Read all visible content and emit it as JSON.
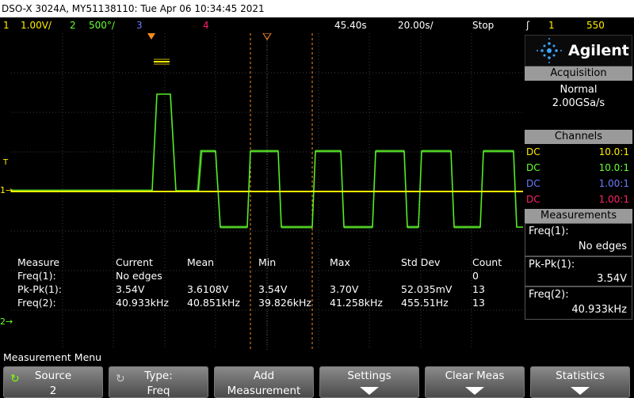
{
  "title": "DSO-X 3024A, MY51138110: Tue Apr 06 10:34:45 2021",
  "status": {
    "ch1_num": "1",
    "ch1_scale": "1.00V/",
    "ch2_num": "2",
    "ch2_scale": "500°/",
    "ch3_num": "3",
    "ch4_num": "4",
    "delay": "45.40s",
    "timebase": "20.00s/",
    "run_state": "Stop",
    "trig_source": "1",
    "trig_level": "550"
  },
  "measure_table": {
    "headers": [
      "Measure",
      "Current",
      "Mean",
      "Min",
      "Max",
      "Std Dev",
      "Count"
    ],
    "rows": [
      [
        "Freq(1):",
        "No edges",
        "",
        "",
        "",
        "",
        "0"
      ],
      [
        "Pk-Pk(1):",
        "3.54V",
        "3.6108V",
        "3.54V",
        "3.70V",
        "52.035mV",
        "13"
      ],
      [
        "Freq(2):",
        "40.933kHz",
        "40.851kHz",
        "39.826kHz",
        "41.258kHz",
        "455.51Hz",
        "13"
      ]
    ]
  },
  "side": {
    "brand": "Agilent",
    "acq_header": "Acquisition",
    "acq_mode": "Normal",
    "acq_rate": "2.00GSa/s",
    "channels_header": "Channels",
    "channels": [
      {
        "coupling": "DC",
        "ratio": "10.0:1",
        "color": "#ffee00"
      },
      {
        "coupling": "DC",
        "ratio": "10.0:1",
        "color": "#66ff33"
      },
      {
        "coupling": "DC",
        "ratio": "1.00:1",
        "color": "#6a7bff"
      },
      {
        "coupling": "DC",
        "ratio": "1.00:1",
        "color": "#ff2266"
      }
    ],
    "meas_header": "Measurements",
    "meas": [
      {
        "label": "Freq(1):",
        "value": "No edges"
      },
      {
        "label": "Pk-Pk(1):",
        "value": "3.54V"
      },
      {
        "label": "Freq(2):",
        "value": "40.933kHz"
      }
    ]
  },
  "menu_title": "Measurement Menu",
  "softkeys": [
    {
      "line1": "Source",
      "line2": "2"
    },
    {
      "line1": "Type:",
      "line2": "Freq"
    },
    {
      "line1": "Add",
      "line2": "Measurement"
    },
    {
      "line1": "Settings",
      "line2": ""
    },
    {
      "line1": "Clear Meas",
      "line2": ""
    },
    {
      "line1": "Statistics",
      "line2": ""
    }
  ],
  "colors": {
    "ch1": "#ffee00",
    "ch2": "#66ff33",
    "ch3": "#6a7bff",
    "ch4": "#ff2266",
    "cursor": "#ff8c1a"
  }
}
